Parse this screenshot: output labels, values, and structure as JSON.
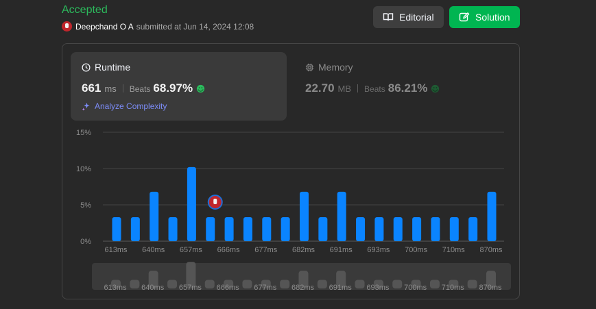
{
  "header": {
    "status": "Accepted",
    "username": "Deepchand O A",
    "submitted_text": "submitted at Jun 14, 2024 12:08",
    "editorial_label": "Editorial",
    "solution_label": "Solution"
  },
  "runtime": {
    "title": "Runtime",
    "value": "661",
    "unit": "ms",
    "beats_label": "Beats",
    "beats_value": "68.97%",
    "analyze_label": "Analyze Complexity"
  },
  "memory": {
    "title": "Memory",
    "value": "22.70",
    "unit": "MB",
    "beats_label": "Beats",
    "beats_value": "86.21%"
  },
  "colors": {
    "accepted": "#2cbb5d",
    "bar": "#0a84ff",
    "solution_button": "#00b551"
  },
  "chart_data": {
    "type": "bar",
    "title": "",
    "xlabel": "",
    "ylabel": "",
    "ylim": [
      0,
      15
    ],
    "y_ticks": [
      "0%",
      "5%",
      "10%",
      "15%"
    ],
    "y_tick_values": [
      0,
      5,
      10,
      15
    ],
    "grid": true,
    "values": [
      3.3,
      3.3,
      6.8,
      3.3,
      10.2,
      3.3,
      3.3,
      3.3,
      3.3,
      3.3,
      6.8,
      3.3,
      6.8,
      3.3,
      3.3,
      3.3,
      3.3,
      3.3,
      3.3,
      3.3,
      6.8
    ],
    "x_tick_labels": [
      "613ms",
      "640ms",
      "657ms",
      "666ms",
      "677ms",
      "682ms",
      "691ms",
      "693ms",
      "700ms",
      "710ms",
      "870ms"
    ],
    "x_tick_bar_index": [
      0,
      2,
      4,
      6,
      8,
      10,
      12,
      14,
      16,
      18,
      20
    ],
    "user_bar_index": 5,
    "y_unit": "%"
  }
}
